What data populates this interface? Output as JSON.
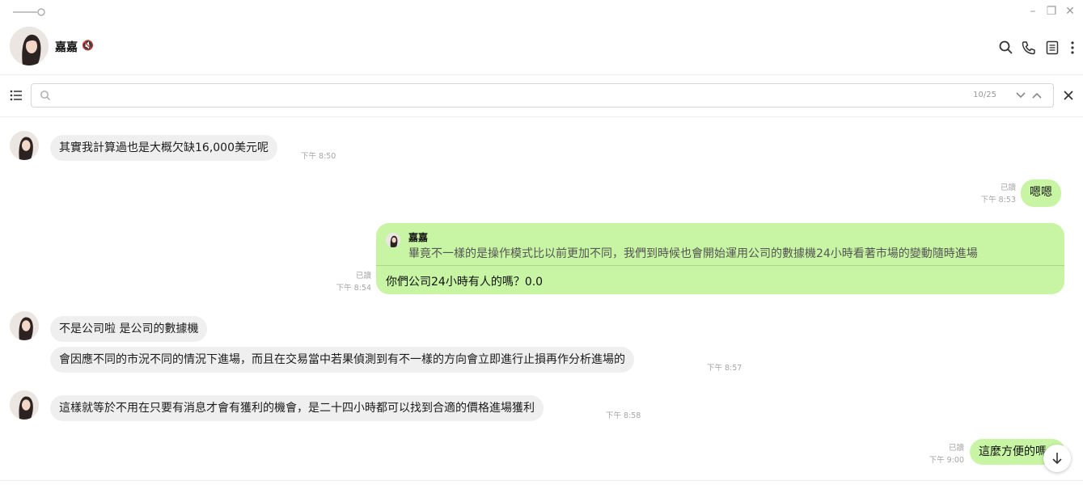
{
  "window": {
    "minimize_icon": "minimize-icon",
    "restore_icon": "restore-icon",
    "close_icon": "close-icon"
  },
  "header": {
    "contact_name": "嘉嘉",
    "muted_icon": "speaker-muted-icon"
  },
  "search": {
    "query": "",
    "placeholder": "",
    "counter": "10/25"
  },
  "messages": [
    {
      "dir": "in",
      "text": "其實我計算過也是大概欠缺16,000美元呢",
      "time": "下午 8:50"
    },
    {
      "dir": "out",
      "text": "嗯嗯",
      "read": "已讀",
      "time": "下午 8:53"
    },
    {
      "dir": "out",
      "reply_to_name": "嘉嘉",
      "reply_to_text": "畢竟不一樣的是操作模式比以前更加不同，我們到時候也會開始運用公司的數據機24小時看著市場的變動隨時進場",
      "text": "你們公司24小時有人的嗎？0.0",
      "read": "已讀",
      "time": "下午 8:54"
    },
    {
      "dir": "in",
      "text": "不是公司啦 是公司的數據機"
    },
    {
      "dir": "in",
      "text": "會因應不同的市況不同的情況下進場，而且在交易當中若果偵測到有不一樣的方向會立即進行止損再作分析進場的",
      "time": "下午 8:57"
    },
    {
      "dir": "in",
      "text": "這樣就等於不用在只要有消息才會有獲利的機會，是二十四小時都可以找到合適的價格進場獲利",
      "time": "下午 8:58"
    },
    {
      "dir": "out",
      "text": "這麼方便的嗎",
      "read": "已讀",
      "time": "下午 9:00"
    }
  ],
  "colors": {
    "outgoing_bubble": "#c7f5a3",
    "incoming_bubble": "#efefef"
  }
}
